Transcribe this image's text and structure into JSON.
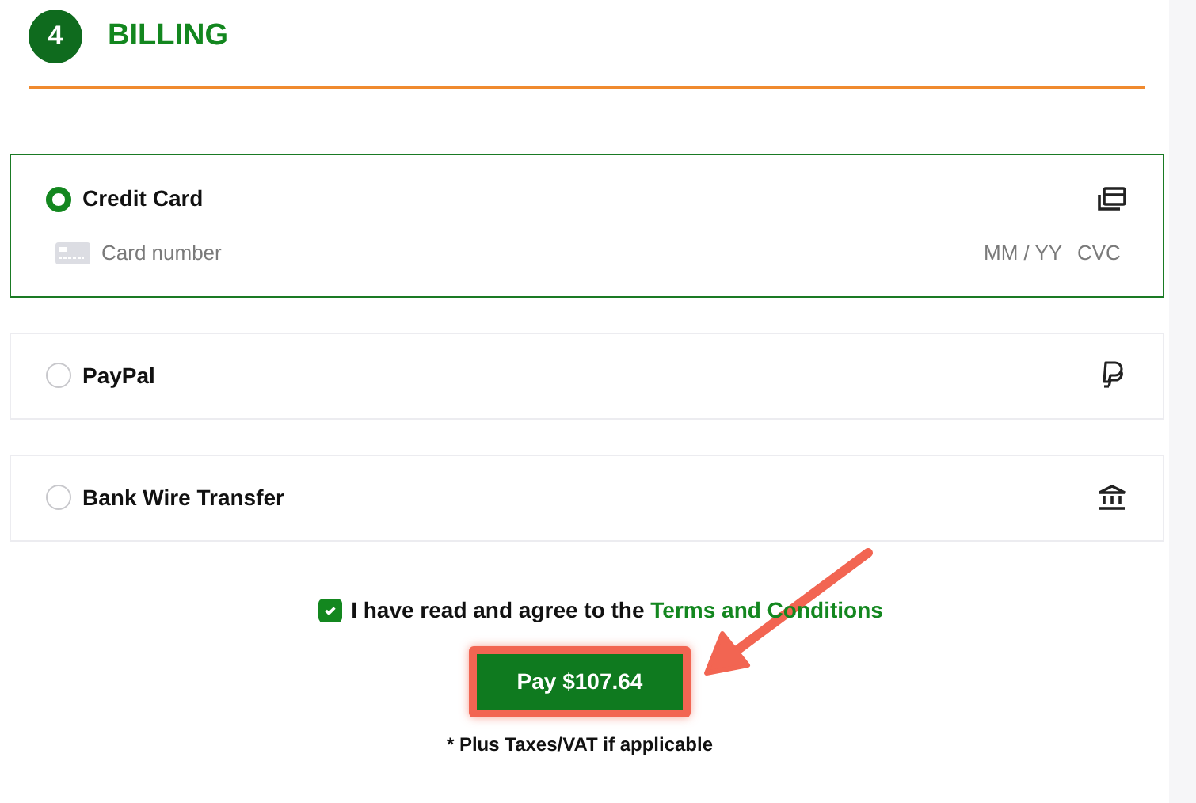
{
  "section": {
    "number": "4",
    "title": "BILLING"
  },
  "payment_methods": [
    {
      "label": "Credit Card",
      "selected": true,
      "kind": "card",
      "card_fields": {
        "number_placeholder": "Card number",
        "expiry_placeholder": "MM / YY",
        "cvc_placeholder": "CVC"
      }
    },
    {
      "label": "PayPal",
      "selected": false,
      "kind": "paypal"
    },
    {
      "label": "Bank Wire Transfer",
      "selected": false,
      "kind": "bank"
    }
  ],
  "agreement": {
    "checked": true,
    "text": "I have read and agree to the ",
    "link": "Terms and Conditions"
  },
  "pay_button": {
    "label": "Pay $107.64",
    "highlighted": true
  },
  "note": "* Plus Taxes/VAT if applicable"
}
